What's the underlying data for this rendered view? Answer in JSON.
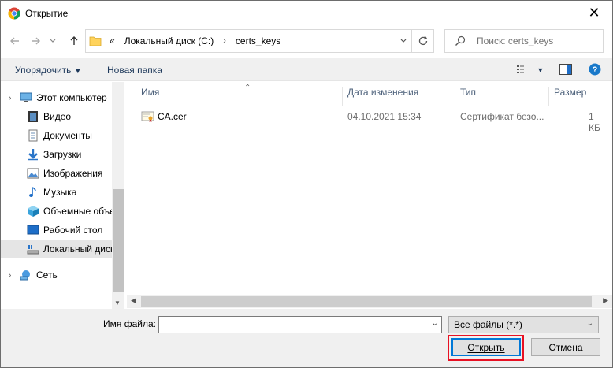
{
  "window": {
    "title": "Открытие",
    "close_glyph": "✕"
  },
  "nav": {
    "back": "back-arrow-icon",
    "forward": "forward-arrow-icon",
    "up": "up-arrow-icon"
  },
  "address": {
    "overflow": "«",
    "crumbs": [
      "Локальный диск (C:)",
      "certs_keys"
    ],
    "separator": "›"
  },
  "search": {
    "placeholder": "Поиск: certs_keys"
  },
  "toolbar": {
    "organize_label": "Упорядочить",
    "new_folder_label": "Новая папка"
  },
  "sidebar": {
    "items": [
      {
        "label": "Этот компьютер",
        "icon": "computer-icon",
        "level": 0
      },
      {
        "label": "Видео",
        "icon": "video-icon",
        "level": 1
      },
      {
        "label": "Документы",
        "icon": "documents-icon",
        "level": 1
      },
      {
        "label": "Загрузки",
        "icon": "downloads-icon",
        "level": 1
      },
      {
        "label": "Изображения",
        "icon": "pictures-icon",
        "level": 1
      },
      {
        "label": "Музыка",
        "icon": "music-icon",
        "level": 1
      },
      {
        "label": "Объемные объекты",
        "icon": "3d-objects-icon",
        "level": 1
      },
      {
        "label": "Рабочий стол",
        "icon": "desktop-icon",
        "level": 1
      },
      {
        "label": "Локальный диск (C:)",
        "icon": "drive-icon",
        "level": 1,
        "selected": true
      },
      {
        "label": "Сеть",
        "icon": "network-icon",
        "level": 0
      }
    ]
  },
  "columns": {
    "name": "Имя",
    "date": "Дата изменения",
    "type": "Тип",
    "size": "Размер"
  },
  "files": [
    {
      "name": "CA.cer",
      "date": "04.10.2021 15:34",
      "type": "Сертификат безо...",
      "size": "1 КБ"
    }
  ],
  "bottom": {
    "filename_label": "Имя файла:",
    "filename_value": "",
    "filetype_value": "Все файлы (*.*)",
    "open_label": "Открыть",
    "cancel_label": "Отмена"
  },
  "colors": {
    "highlight": "#e81123",
    "accent": "#0078d7",
    "help": "#1979ca"
  }
}
